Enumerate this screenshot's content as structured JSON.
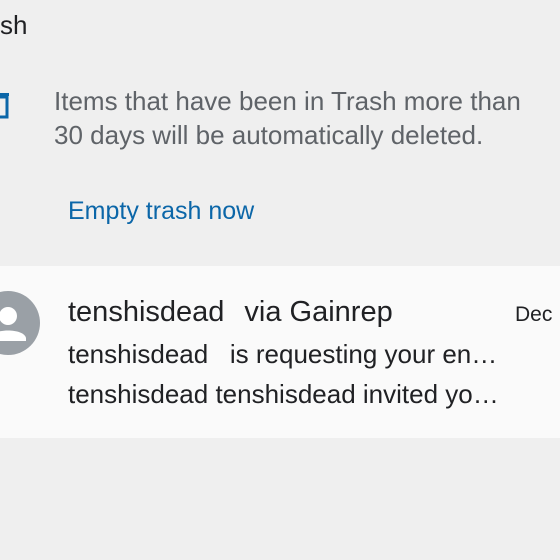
{
  "header": {
    "title_fragment": "sh"
  },
  "banner": {
    "icon": "trash-icon",
    "line1": "Items that have been in Trash more than",
    "line2": "30 days will be automatically deleted.",
    "action_label": "Empty trash now",
    "action_color": "#0b66a8"
  },
  "messages": [
    {
      "avatar_icon": "person-icon",
      "sender": "tenshisdead",
      "via": "via Gainrep",
      "date": "Dec",
      "subject": "tenshisdead   is requesting your en…",
      "snippet": "tenshisdead tenshisdead invited yo…"
    }
  ],
  "colors": {
    "background": "#efefef",
    "row_background": "#fafafa",
    "primary_text": "#202124",
    "secondary_text": "#5f6368",
    "avatar": "#9aa0a6"
  }
}
